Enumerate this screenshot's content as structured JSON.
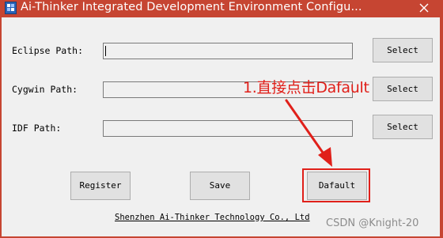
{
  "window": {
    "title": "Ai-Thinker Integrated  Development Environment Configu..."
  },
  "rows": [
    {
      "label": "Eclipse Path:",
      "value": "",
      "button": "Select"
    },
    {
      "label": "Cygwin Path:",
      "value": "",
      "button": "Select"
    },
    {
      "label": "IDF Path:",
      "value": "",
      "button": "Select"
    }
  ],
  "actions": {
    "register": "Register",
    "save": "Save",
    "default": "Dafault"
  },
  "footer": "Shenzhen Ai-Thinker Technology Co., Ltd",
  "annotation": {
    "text": "1.直接点击Dafault",
    "color": "#e0201a"
  },
  "watermark": "CSDN @Knight-20",
  "colors": {
    "titlebar": "#c64532",
    "client": "#f0f0f0",
    "annotation": "#e0201a"
  },
  "icons": {
    "app": "app-icon",
    "close": "close-icon",
    "arrow": "annotation-arrow"
  }
}
